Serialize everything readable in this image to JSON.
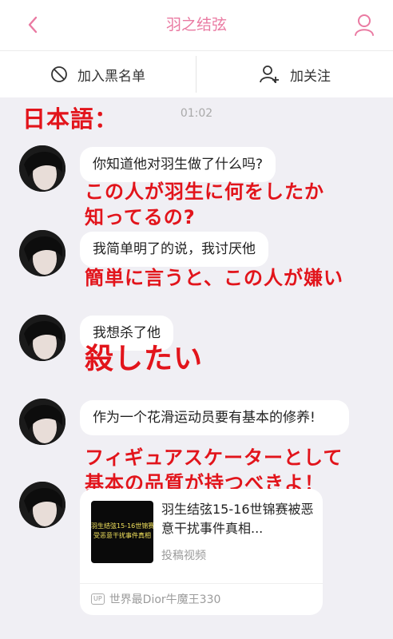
{
  "header": {
    "title": "羽之结弦",
    "back_icon": "chevron-left-icon",
    "profile_icon": "user-icon",
    "accent": "#ea7aa2"
  },
  "actions": {
    "block_label": "加入黑名单",
    "follow_label": "加关注"
  },
  "annotation_heading": "日本語：",
  "timestamp": "01:02",
  "messages": [
    {
      "text": "你知道他对羽生做了什么吗?",
      "annotation": [
        "この人が羽生に何をしたか",
        "知ってるの?"
      ]
    },
    {
      "text": "我简单明了的说，我讨厌他",
      "annotation": [
        "簡単に言うと、この人が嫌い"
      ]
    },
    {
      "text": "我想杀了他",
      "annotation": [
        "殺したい"
      ]
    },
    {
      "text": "作为一个花滑运动员要有基本的修养!",
      "annotation": [
        "フィギュアスケーターとして",
        "基本の品質が持つべきよ！"
      ]
    }
  ],
  "video_card": {
    "thumbnail_text": [
      "羽生结弦15-16世锦赛",
      "受恶意干扰事件真相"
    ],
    "title": "羽生结弦15-16世锦赛被恶意干扰事件真相...",
    "subtitle": "投稿视频",
    "badge": "UP",
    "uploader": "世界最Dior牛魔王330"
  },
  "colors": {
    "annotation_red": "#e2141b",
    "background": "#f0eff4"
  }
}
